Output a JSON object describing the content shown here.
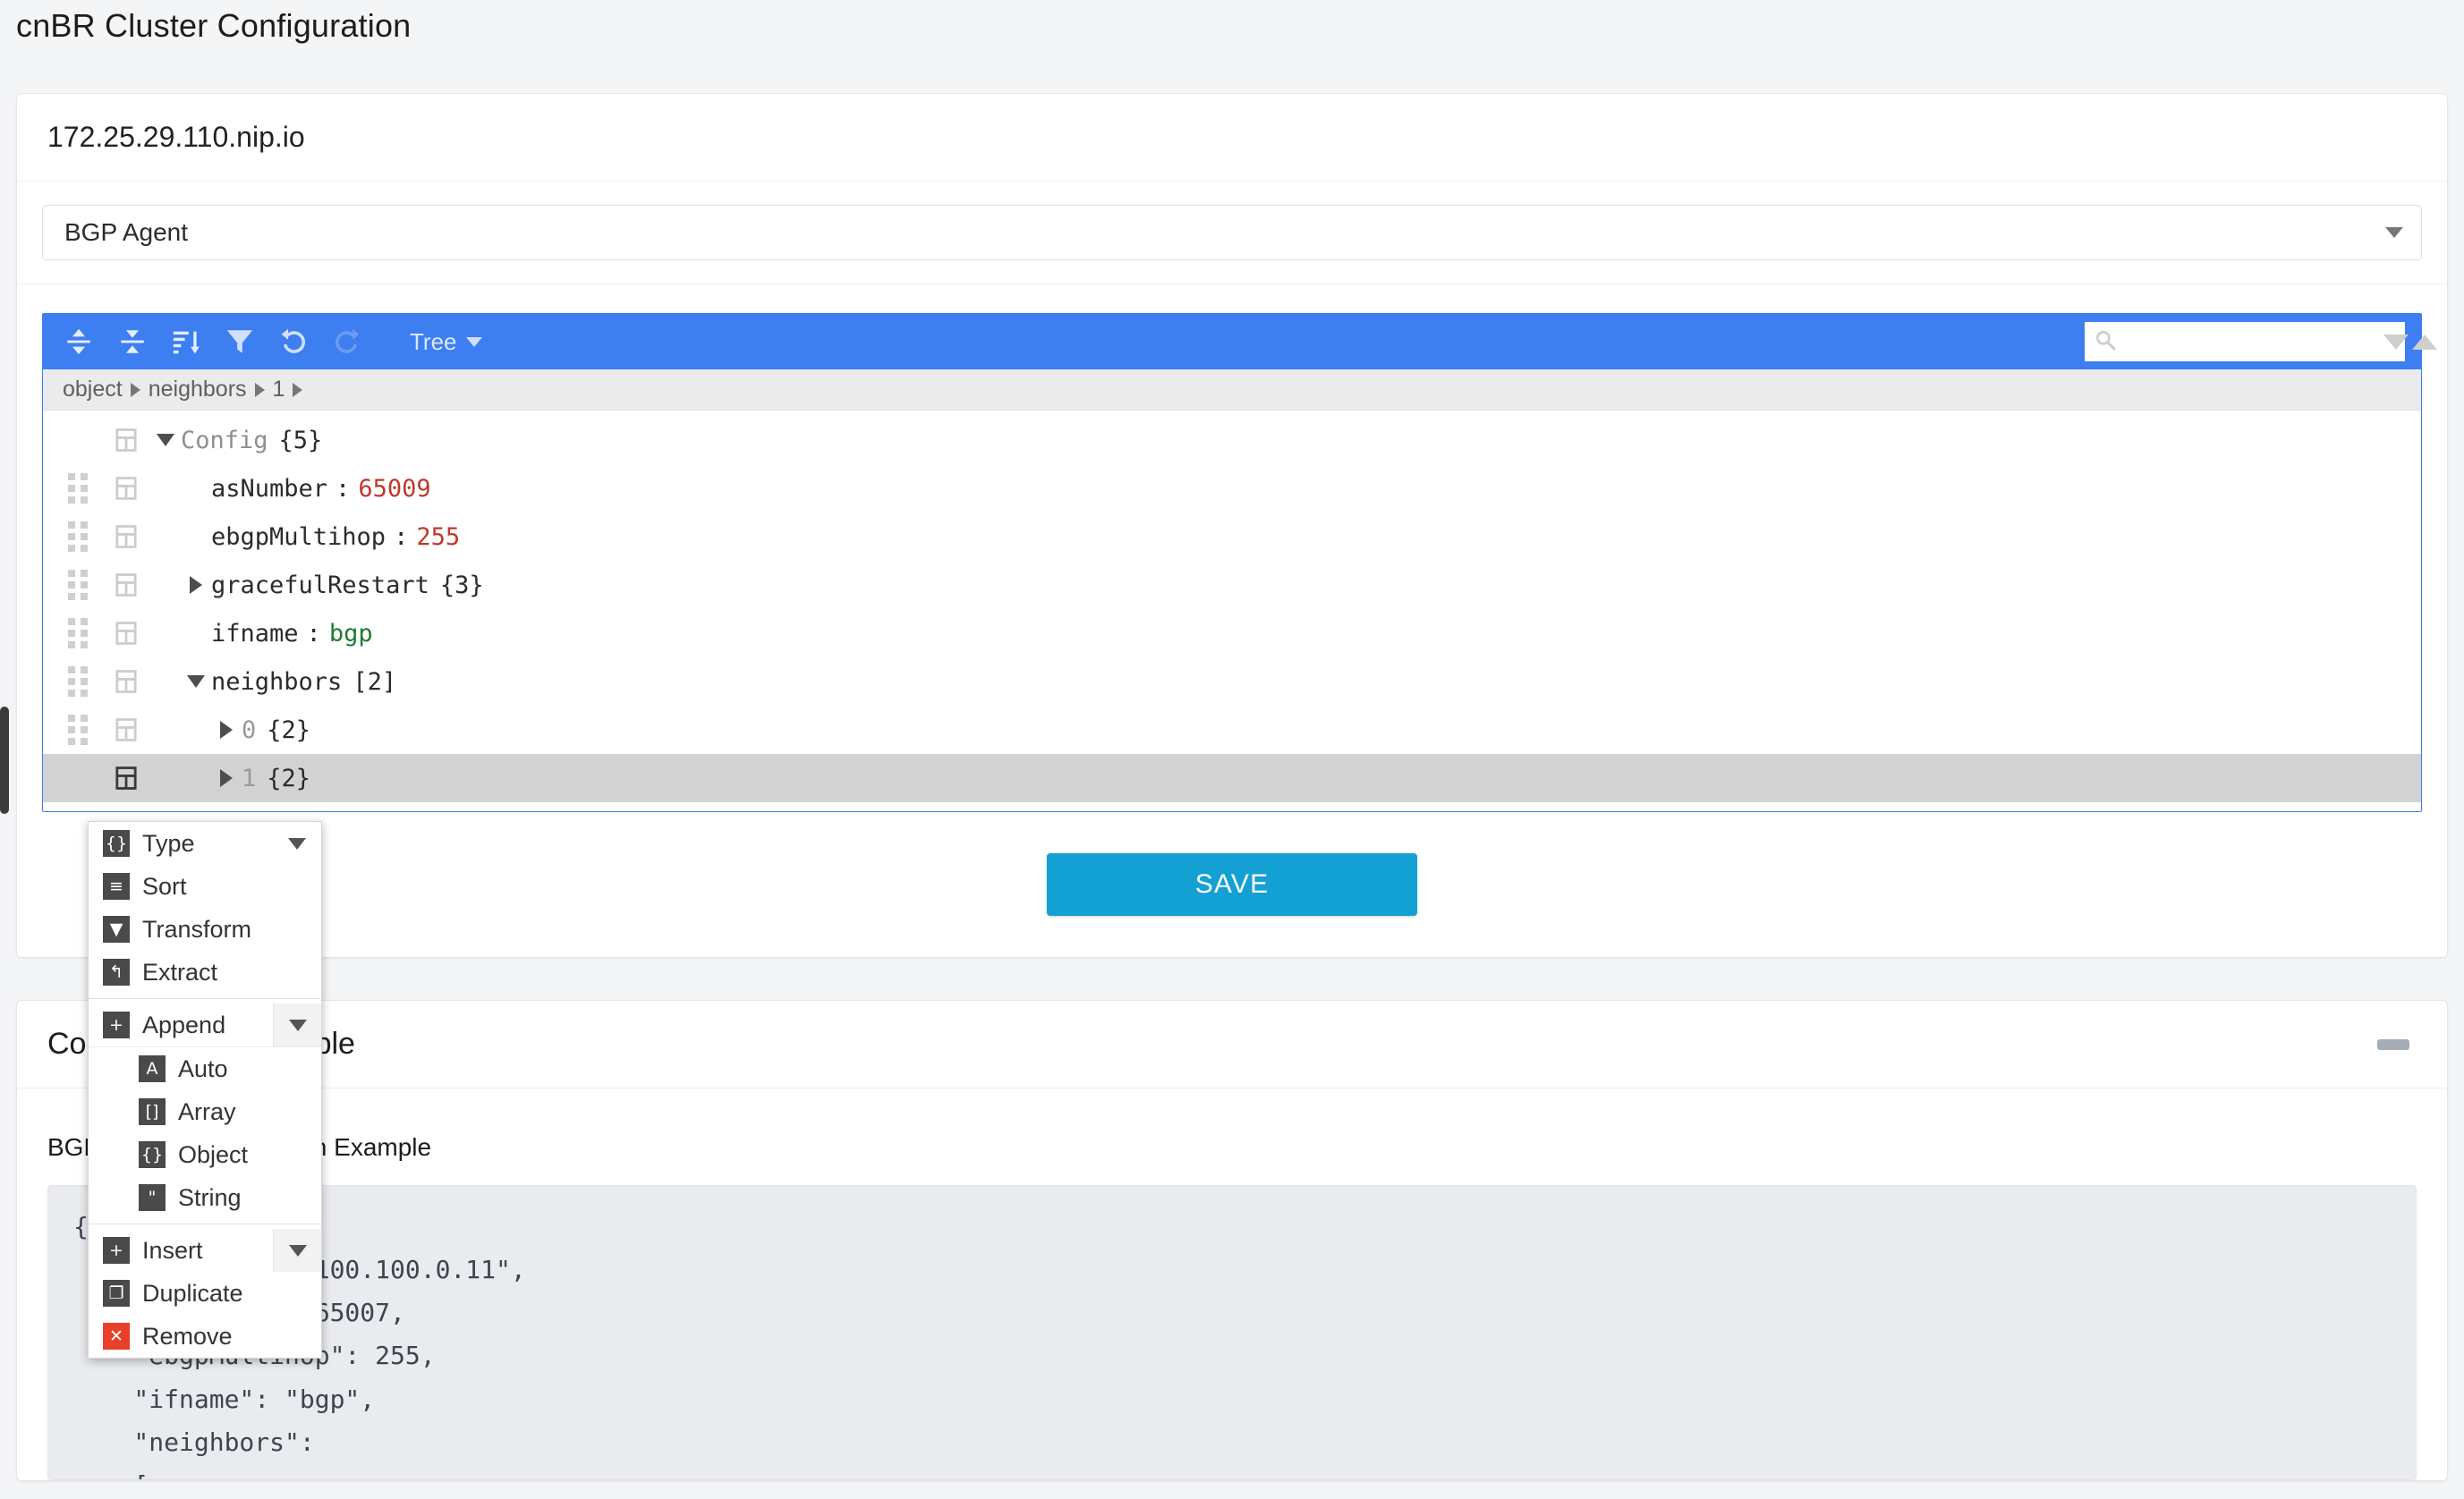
{
  "page": {
    "title": "cnBR Cluster Configuration"
  },
  "cluster_card": {
    "host": "172.25.29.110.nip.io",
    "agent_select": {
      "value": "BGP Agent",
      "icon": "chevron-down-icon"
    },
    "save_label": "SAVE"
  },
  "json_editor": {
    "toolbar": {
      "expand_all": "expand-all-icon",
      "collapse_all": "collapse-all-icon",
      "sort": "sort-icon",
      "transform": "filter-icon",
      "undo": "undo-icon",
      "redo": "redo-icon",
      "mode_label": "Tree"
    },
    "search": {
      "value": "",
      "placeholder": "",
      "icon": "search-icon",
      "next_icon": "triangle-down-icon",
      "prev_icon": "triangle-up-icon"
    },
    "breadcrumb": [
      "object",
      "neighbors",
      "1"
    ],
    "rows": [
      {
        "indent": 0,
        "expander": "down",
        "key": "Config",
        "key_class": "k-root",
        "value": "{5}",
        "value_class": "v-cnt",
        "has_colon": false,
        "drag": false,
        "selected": false
      },
      {
        "indent": 1,
        "expander": "none",
        "key": "asNumber",
        "key_class": "k-field",
        "value": "65009",
        "value_class": "v-num",
        "has_colon": true,
        "drag": true,
        "selected": false
      },
      {
        "indent": 1,
        "expander": "none",
        "key": "ebgpMultihop",
        "key_class": "k-field",
        "value": "255",
        "value_class": "v-num",
        "has_colon": true,
        "drag": true,
        "selected": false
      },
      {
        "indent": 1,
        "expander": "right",
        "key": "gracefulRestart",
        "key_class": "k-field",
        "value": "{3}",
        "value_class": "v-cnt",
        "has_colon": false,
        "drag": true,
        "selected": false
      },
      {
        "indent": 1,
        "expander": "none",
        "key": "ifname",
        "key_class": "k-field",
        "value": "bgp",
        "value_class": "v-str",
        "has_colon": true,
        "drag": true,
        "selected": false
      },
      {
        "indent": 1,
        "expander": "down",
        "key": "neighbors",
        "key_class": "k-field",
        "value": "[2]",
        "value_class": "v-cnt",
        "has_colon": false,
        "drag": true,
        "selected": false
      },
      {
        "indent": 2,
        "expander": "right",
        "key": "0",
        "key_class": "k-index",
        "value": "{2}",
        "value_class": "v-cnt",
        "has_colon": false,
        "drag": true,
        "selected": false
      },
      {
        "indent": 2,
        "expander": "right",
        "key": "1",
        "key_class": "k-index",
        "value": "{2}",
        "value_class": "v-cnt",
        "has_colon": false,
        "drag": false,
        "selected": true
      }
    ]
  },
  "context_menu": {
    "items": [
      {
        "label": "Type",
        "icon": "braces-icon",
        "icon_glyph": "{}",
        "submenu_caret": true,
        "caret_boxed": false,
        "danger": false
      },
      {
        "label": "Sort",
        "icon": "sort-lines-icon",
        "icon_glyph": "≡",
        "submenu_caret": false,
        "caret_boxed": false,
        "danger": false
      },
      {
        "label": "Transform",
        "icon": "funnel-icon",
        "icon_glyph": "▼",
        "submenu_caret": false,
        "caret_boxed": false,
        "danger": false
      },
      {
        "label": "Extract",
        "icon": "extract-arrow-icon",
        "icon_glyph": "↰",
        "submenu_caret": false,
        "caret_boxed": false,
        "danger": false
      }
    ],
    "append": {
      "label": "Append",
      "icon": "plus-icon",
      "icon_glyph": "+",
      "caret_icon": "triangle-down-icon"
    },
    "append_submenu": [
      {
        "label": "Auto",
        "icon": "letter-a-icon",
        "icon_glyph": "A"
      },
      {
        "label": "Array",
        "icon": "brackets-icon",
        "icon_glyph": "[]"
      },
      {
        "label": "Object",
        "icon": "braces-icon",
        "icon_glyph": "{}"
      },
      {
        "label": "String",
        "icon": "quote-icon",
        "icon_glyph": "\""
      }
    ],
    "tail_items": [
      {
        "label": "Insert",
        "icon": "plus-icon",
        "icon_glyph": "+",
        "submenu_caret": true,
        "danger": false
      },
      {
        "label": "Duplicate",
        "icon": "duplicate-icon",
        "icon_glyph": "❐",
        "submenu_caret": false,
        "danger": false
      },
      {
        "label": "Remove",
        "icon": "close-x-icon",
        "icon_glyph": "✕",
        "submenu_caret": false,
        "danger": true
      }
    ]
  },
  "example_card": {
    "title": "Configuration Example",
    "collapse_icon": "minus-icon",
    "subtitle": "BGP Agent Configuration Example",
    "code": "{\n    \"agentIp\": \"100.100.0.11\",\n    \"asNumber\": 65007,\n    \"ebgpMultihop\": 255,\n    \"ifname\": \"bgp\",\n    \"neighbors\":\n    ["
  },
  "colors": {
    "accent_blue": "#3d7ef0",
    "save_blue": "#13a0d3",
    "number_red": "#c0392b",
    "string_green": "#1f7a33",
    "remove_red": "#e8402a",
    "page_bg": "#f4f5f7"
  }
}
